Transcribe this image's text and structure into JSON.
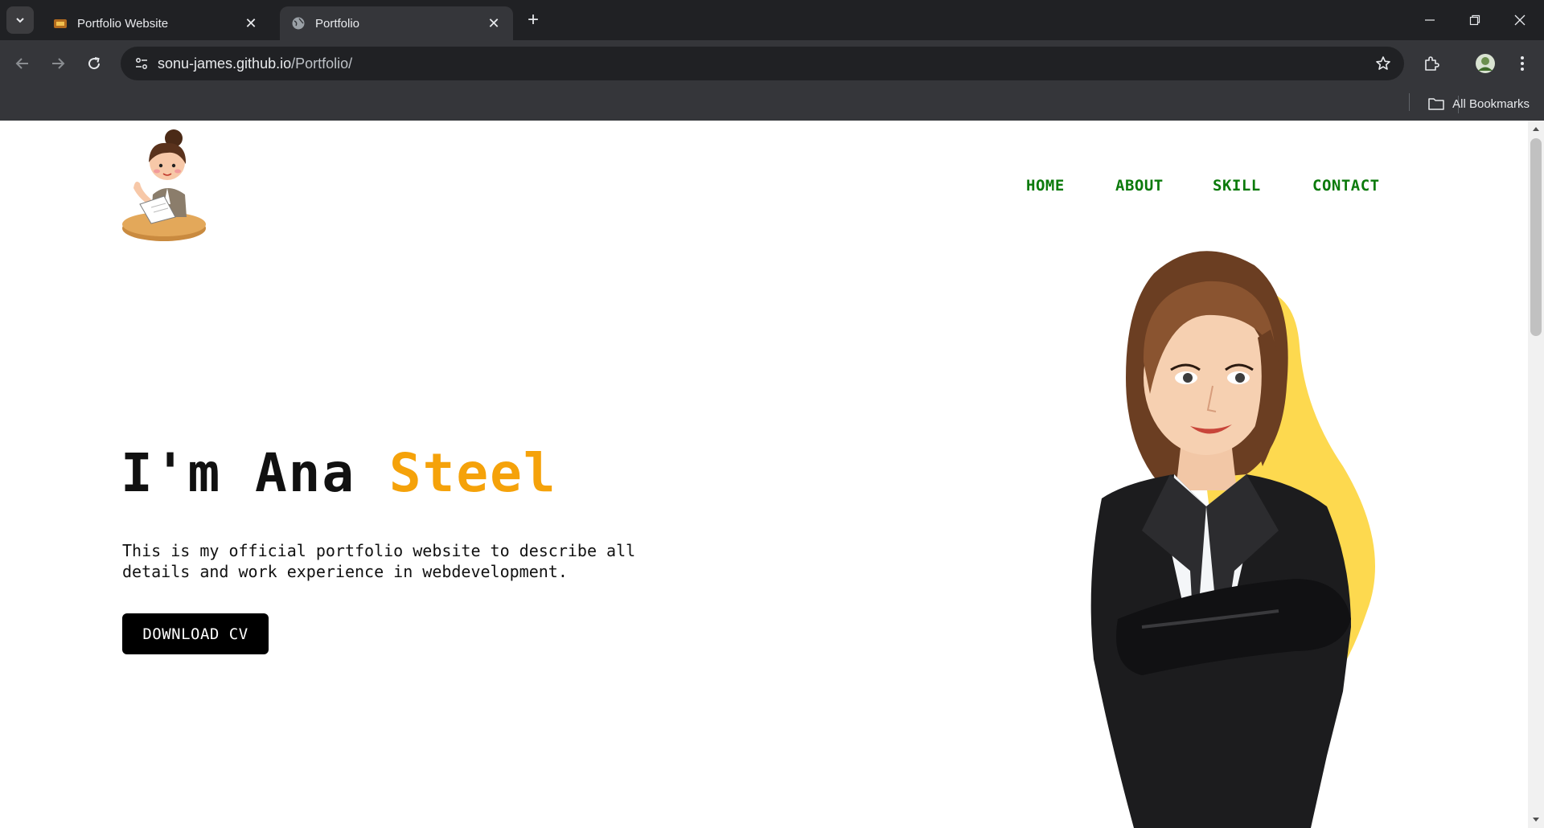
{
  "browser": {
    "tabs": [
      {
        "title": "Portfolio Website",
        "active": false
      },
      {
        "title": "Portfolio",
        "active": true
      }
    ],
    "url_host": "sonu-james.github.io",
    "url_path": "/Portfolio/",
    "bookmarks_label": "All Bookmarks"
  },
  "site": {
    "nav": [
      "HOME",
      "ABOUT",
      "SKILL",
      "CONTACT"
    ],
    "hero": {
      "title_prefix": "I'm Ana ",
      "title_accent": "Steel",
      "description": "This is my official portfolio website to describe all details and work experience in webdevelopment.",
      "button_label": "DOWNLOAD CV"
    }
  },
  "colors": {
    "nav": "#0b7a0b",
    "accent": "#f5a20a",
    "blob": "#fdd94f",
    "button": "#000000"
  },
  "icons": [
    "tab-search-icon",
    "close-icon",
    "plus-icon",
    "minimize-icon",
    "restore-icon",
    "back-icon",
    "forward-icon",
    "reload-icon",
    "site-info-icon",
    "star-icon",
    "extensions-icon",
    "profile-avatar",
    "kebab-menu-icon",
    "folder-icon"
  ]
}
